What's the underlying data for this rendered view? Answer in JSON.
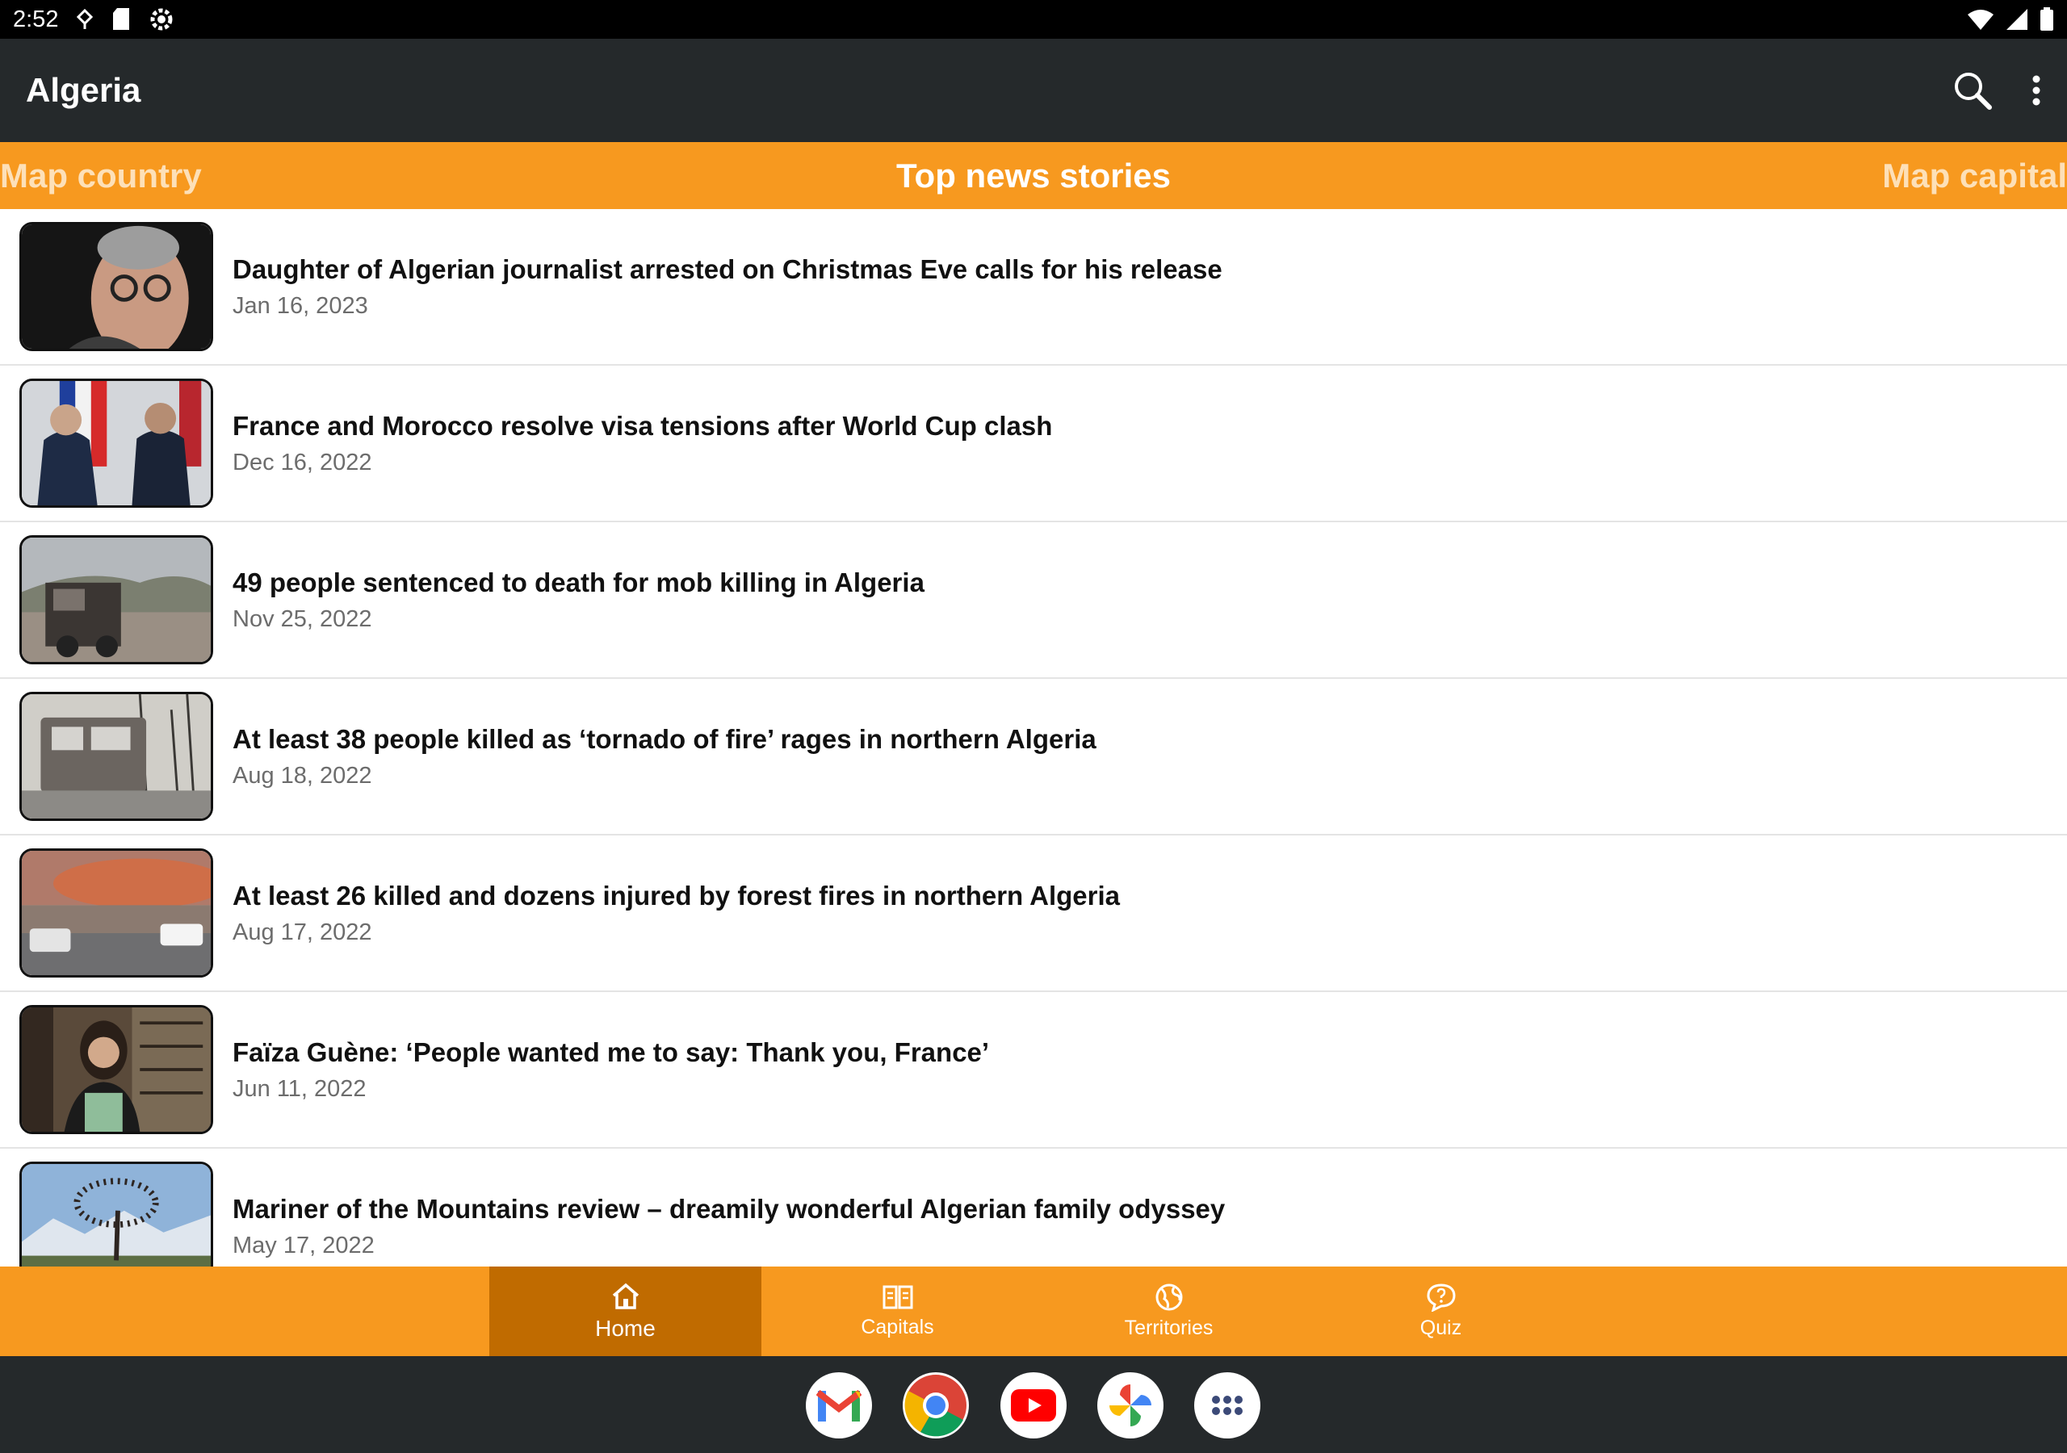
{
  "status_bar": {
    "time": "2:52"
  },
  "app_bar": {
    "title": "Algeria"
  },
  "tabs": {
    "left": "Map country",
    "center": "Top news stories",
    "right": "Map capital"
  },
  "news": [
    {
      "title": "Daughter of Algerian journalist arrested on Christmas Eve calls for his release",
      "date": "Jan 16, 2023",
      "thumb": "portrait-glasses"
    },
    {
      "title": "France and Morocco resolve visa tensions after World Cup clash",
      "date": "Dec 16, 2022",
      "thumb": "handshake-flags"
    },
    {
      "title": "49 people sentenced to death for mob killing in Algeria",
      "date": "Nov 25, 2022",
      "thumb": "burnt-truck"
    },
    {
      "title": "At least 38 people killed as ‘tornado of fire’ rages in northern Algeria",
      "date": "Aug 18, 2022",
      "thumb": "burnt-bus"
    },
    {
      "title": "At least 26 killed and dozens injured by forest fires in northern Algeria",
      "date": "Aug 17, 2022",
      "thumb": "street-smoke"
    },
    {
      "title": "Faïza Guène: ‘People wanted me to say: Thank you, France’",
      "date": "Jun 11, 2022",
      "thumb": "woman-bookshelf"
    },
    {
      "title": "Mariner of the Mountains review – dreamily wonderful Algerian family odyssey",
      "date": "May 17, 2022",
      "thumb": "tree-mountains"
    }
  ],
  "bottom_nav": [
    {
      "label": "Home",
      "icon": "home-icon",
      "active": true
    },
    {
      "label": "Capitals",
      "icon": "book-icon",
      "active": false
    },
    {
      "label": "Territories",
      "icon": "globe-icon",
      "active": false
    },
    {
      "label": "Quiz",
      "icon": "question-bubble-icon",
      "active": false
    }
  ],
  "dock": [
    "gmail-icon",
    "chrome-icon",
    "youtube-icon",
    "photos-icon",
    "app-drawer-icon"
  ],
  "colors": {
    "accent": "#f7991f",
    "accent_active": "#c06b00",
    "toolbar": "#25292b"
  }
}
